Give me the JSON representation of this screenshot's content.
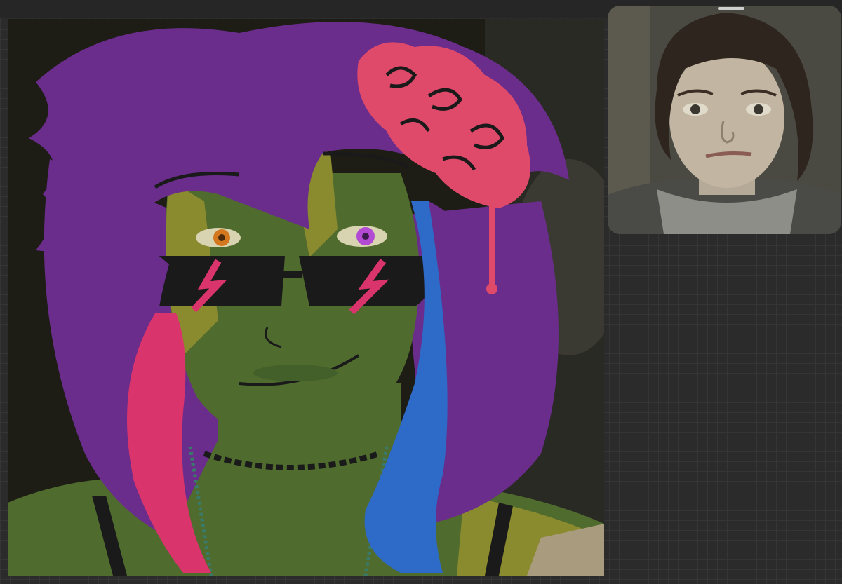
{
  "app": {
    "canvas": {
      "content": "digital-illustration",
      "background": "#2b2b2b"
    },
    "reference_window": {
      "content": "reference-photo"
    }
  },
  "colors": {
    "grid_background": "#2b2b2b",
    "hair": "#6a2d8c",
    "skin": "#4f6b2e",
    "skin_shadow": "#8a8a2e",
    "pink_streak": "#d9346b",
    "blue_streak": "#2e6ac8",
    "flower": "#e04a6a",
    "glasses": "#1a1a1a"
  },
  "icons": [
    "drag-handle-icon"
  ]
}
